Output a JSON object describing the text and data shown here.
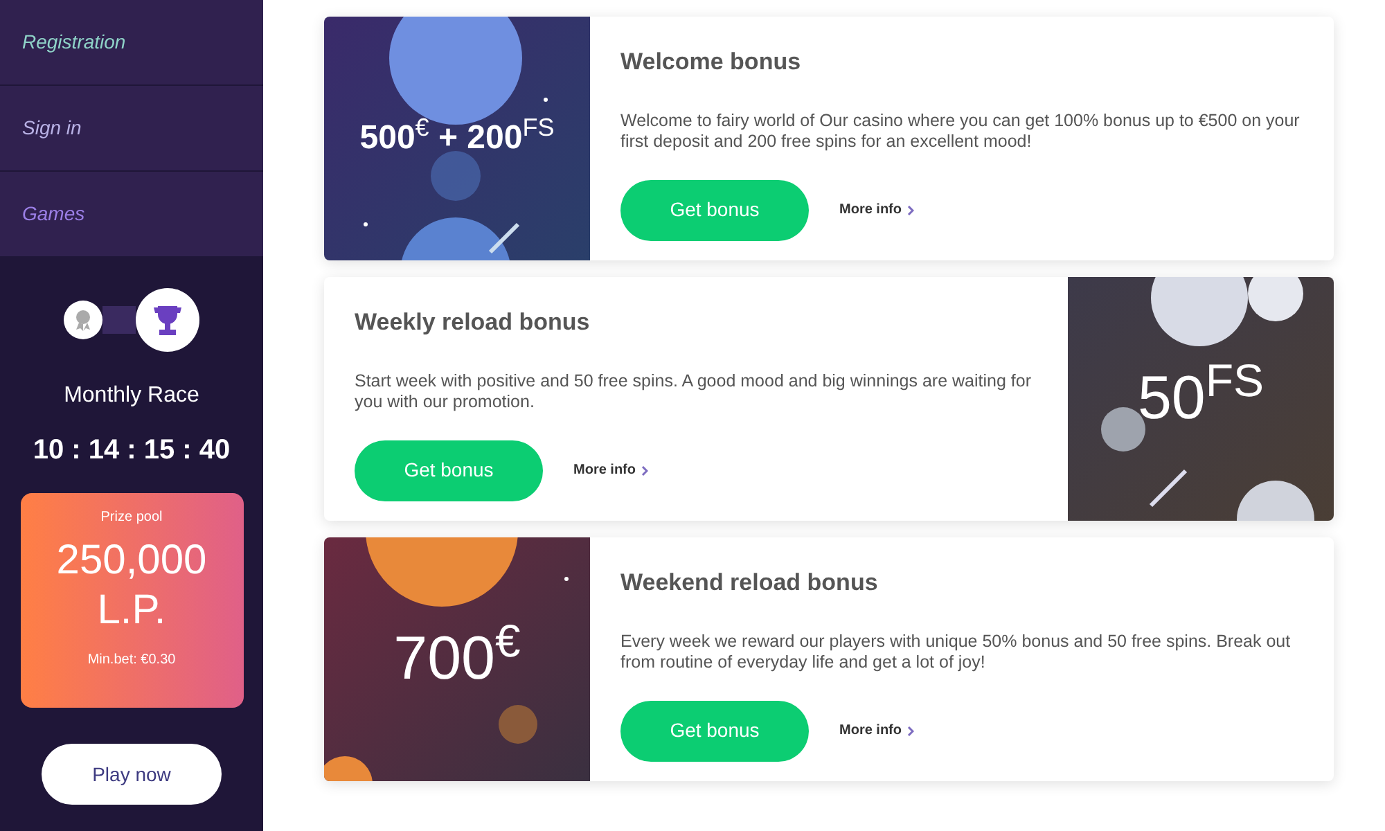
{
  "sidebar": {
    "items": [
      {
        "label": "Registration",
        "color": "#8fd3c8"
      },
      {
        "label": "Sign in",
        "color": "#b9b2e6"
      },
      {
        "label": "Games",
        "color": "#9b7fe6"
      }
    ]
  },
  "race": {
    "title": "Monthly Race",
    "countdown": "10 : 14 : 15 : 40",
    "prize": {
      "label": "Prize pool",
      "amount": "250,000 L.P.",
      "min_bet": "Min.bet: €0.30"
    },
    "button": "Play now"
  },
  "bonuses": [
    {
      "title": "Welcome bonus",
      "text": "Welcome to fairy world of Our casino where you can get 100% bonus up to €500 on your first deposit and 200 free spins for an excellent mood!",
      "image_text": "**500**$^{€}$ **+ 200**$^{FS}$",
      "image_right": false,
      "kind": "blue",
      "button": "Get bonus",
      "link": "More info"
    },
    {
      "title": "Weekly reload bonus",
      "text": "Start week with positive and 50 free spins. A good mood and big winnings are waiting for you with our promotion.",
      "image_text": "50$^{FS}$",
      "image_right": true,
      "kind": "moon",
      "button": "Get bonus",
      "link": "More info"
    },
    {
      "title": "Weekend reload bonus",
      "text": "Every week we reward our players with unique 50% bonus and 50 free spins. Break out from routine of everyday life and get a lot of joy!",
      "image_text": "700$^{€}$",
      "image_right": false,
      "kind": "mars",
      "button": "Get bonus",
      "link": "More info"
    }
  ]
}
